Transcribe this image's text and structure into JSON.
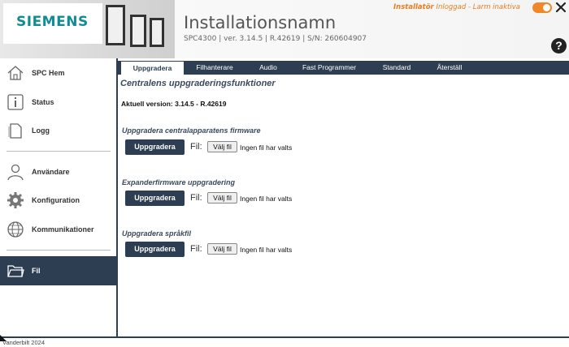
{
  "header": {
    "logo": "SIEMENS",
    "installation_name": "Installationsnamn",
    "system_info": "SPC4300  |  ver. 3.14.5  |  R.42619  |  S/N: 260604907",
    "status_installer": "Installatör",
    "status_rest": "Inloggad - Larm inaktiva",
    "help": "?"
  },
  "sidebar": {
    "items": [
      {
        "label": "SPC Hem",
        "icon": "home-icon"
      },
      {
        "label": "Status",
        "icon": "info-icon"
      },
      {
        "label": "Logg",
        "icon": "log-icon"
      },
      {
        "label": "Användare",
        "icon": "user-icon"
      },
      {
        "label": "Konfiguration",
        "icon": "gear-icon"
      },
      {
        "label": "Kommunikationer",
        "icon": "globe-icon"
      },
      {
        "label": "Fil",
        "icon": "folder-icon"
      }
    ],
    "active": "Fil"
  },
  "tabs": [
    {
      "label": "Uppgradera"
    },
    {
      "label": "Filhanterare"
    },
    {
      "label": "Audio"
    },
    {
      "label": "Fast Programmer"
    },
    {
      "label": "Standard"
    },
    {
      "label": "Återställ"
    }
  ],
  "main": {
    "title": "Centralens uppgraderingsfunktioner",
    "version": "Aktuell version: 3.14.5 - R.42619",
    "sections": [
      {
        "title": "Uppgradera centralapparatens firmware",
        "button": "Uppgradera",
        "fil_label": "Fil:",
        "choose": "Välj fil",
        "none": "Ingen fil har valts"
      },
      {
        "title": "Expanderfirmware uppgradering",
        "button": "Uppgradera",
        "fil_label": "Fil:",
        "choose": "Välj fil",
        "none": "Ingen fil har valts"
      },
      {
        "title": "Uppgradera språkfil",
        "button": "Uppgradera",
        "fil_label": "Fil:",
        "choose": "Välj fil",
        "none": "Ingen fil har valts"
      }
    ]
  },
  "footer": {
    "copyright": "Vanderbilt 2024"
  },
  "colors": {
    "navy": "#2d3e52",
    "brand": "#0f8c96",
    "accent": "#f0882a"
  }
}
